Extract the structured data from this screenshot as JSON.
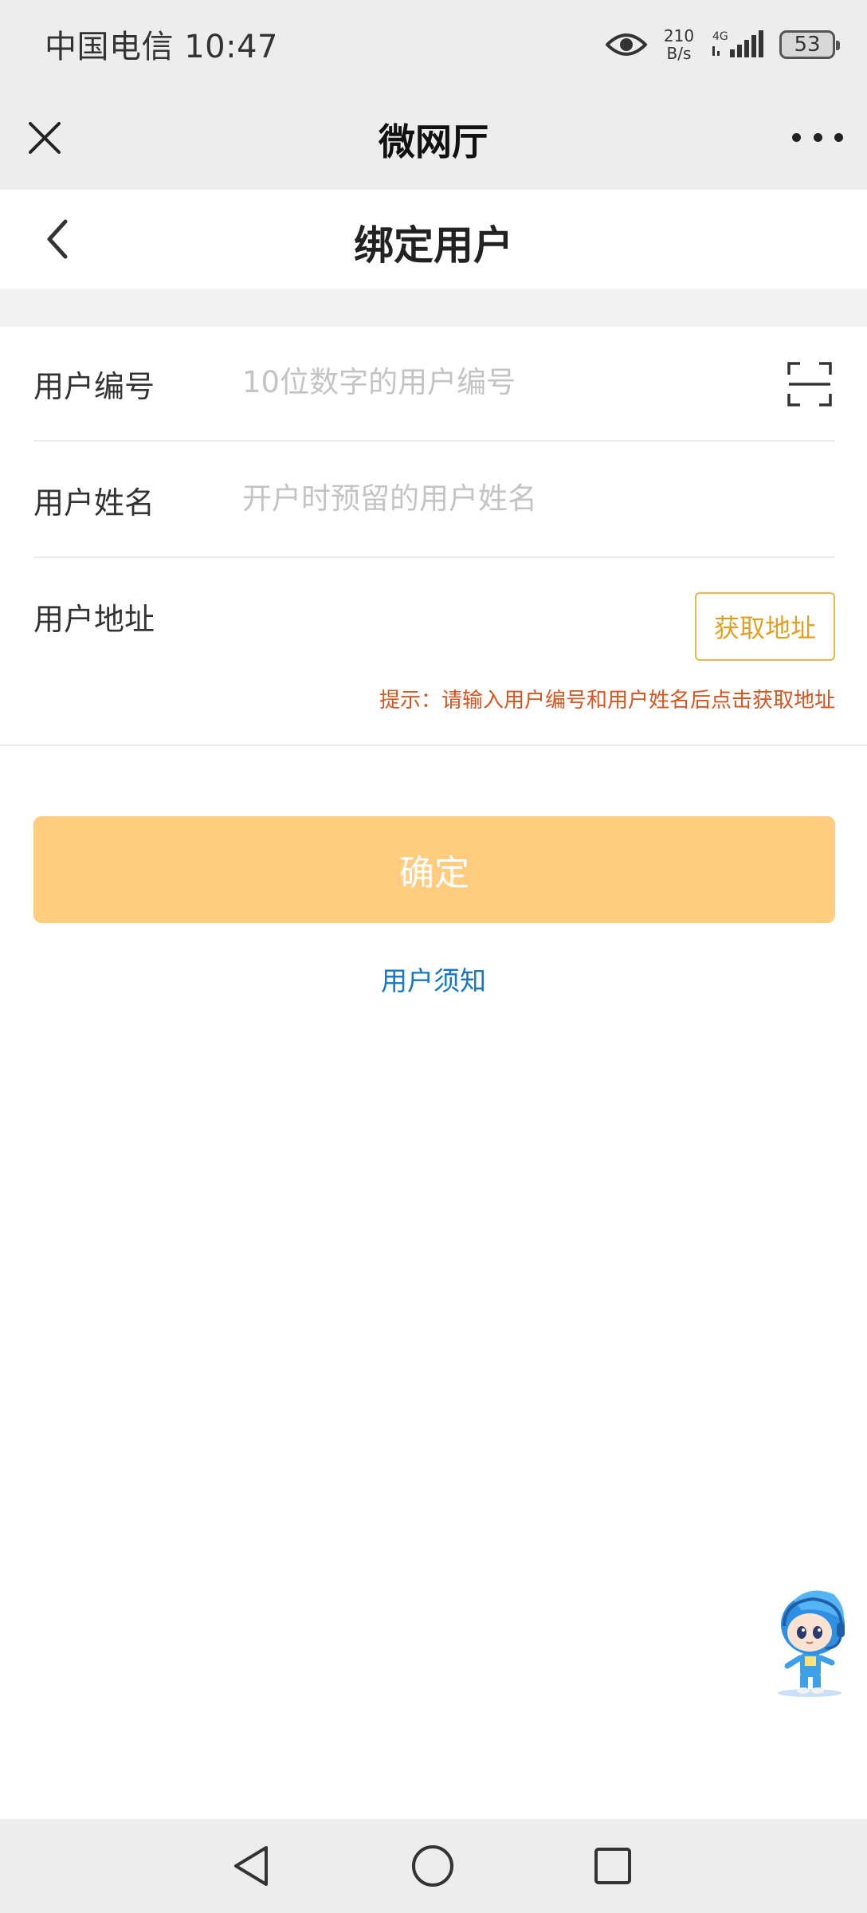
{
  "status_bar": {
    "carrier_time": "中国电信 10:47",
    "net_speed_value": "210",
    "net_speed_unit": "B/s",
    "network": "4G",
    "battery": "53"
  },
  "wechat_bar": {
    "title": "微网厅",
    "close_icon": "close-icon",
    "more_icon": "more-icon"
  },
  "header": {
    "title": "绑定用户",
    "back_icon": "back-chevron-icon"
  },
  "form": {
    "user_number": {
      "label": "用户编号",
      "value": "",
      "placeholder": "10位数字的用户编号"
    },
    "user_name": {
      "label": "用户姓名",
      "value": "",
      "placeholder": "开户时预留的用户姓名"
    },
    "user_address": {
      "label": "用户地址",
      "button": "获取地址"
    },
    "hint": "提示：请输入用户编号和用户姓名后点击获取地址"
  },
  "confirm_button": "确定",
  "notice_link": "用户须知",
  "colors": {
    "accent_orange": "#ffcc80",
    "hint_red": "#d9541e",
    "link_blue": "#1676c6",
    "button_border": "#e8b84d"
  },
  "nav_bar": {
    "icons": [
      "back-triangle-icon",
      "home-circle-icon",
      "recent-square-icon"
    ]
  }
}
